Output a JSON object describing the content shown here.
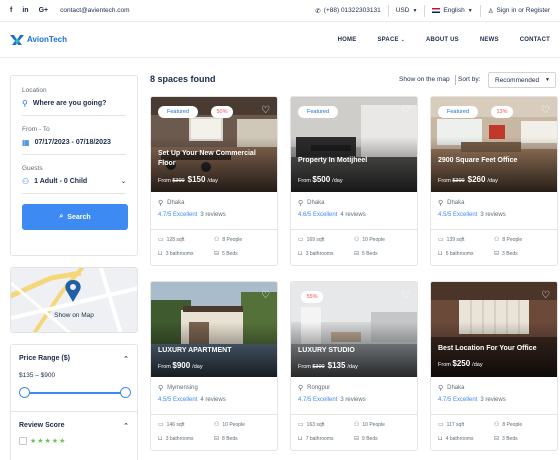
{
  "topbar": {
    "social": [
      "f",
      "in",
      "G+"
    ],
    "email": "contact@avientech.com",
    "phone": "(+88) 01322303131",
    "currency": "USD",
    "language": "English",
    "signin": "Sign in or Register"
  },
  "nav": {
    "logo": "AvionTech",
    "items": [
      "HOME",
      "SPACE",
      "ABOUT US",
      "NEWS",
      "CONTACT"
    ]
  },
  "search": {
    "location_label": "Location",
    "location_placeholder": "Where are you going?",
    "date_label": "From - To",
    "date_value": "07/17/2023 - 07/18/2023",
    "guests_label": "Guests",
    "guests_value": "1 Adult - 0 Child",
    "button": "Search"
  },
  "map": {
    "label": "Show on Map"
  },
  "filters": {
    "price_title": "Price Range ($)",
    "price_range": "$135 – $900",
    "price_min_fraction": 0.0,
    "price_max_fraction": 1.0,
    "review_title": "Review Score",
    "review_stars": 5
  },
  "results": {
    "count_label": "8 spaces found",
    "map_toggle": "Show on the map",
    "sort_label": "Sort by:",
    "sort_value": "Recommended"
  },
  "colors": {
    "accent": "#3d8bf2",
    "navy": "#1a2b48",
    "sale": "#f2514f",
    "green": "#6ac259"
  },
  "listings": [
    {
      "featured": "Featured",
      "discount": "50%",
      "title": "Set Up Your New Commercial Floor",
      "from": "From",
      "old_price": "$300",
      "price": "$150",
      "per": "/day",
      "location": "Dhaka",
      "rating": "4.7/5 Excellent",
      "reviews": "3 reviews",
      "area": "128 sqft",
      "people": "8 People",
      "baths": "3 bathrooms",
      "beds": "5 Beds"
    },
    {
      "featured": "Featured",
      "discount": "",
      "title": "Property In Motijheel",
      "from": "From",
      "old_price": "",
      "price": "$500",
      "per": "/day",
      "location": "Dhaka",
      "rating": "4.6/5 Excellent",
      "reviews": "4 reviews",
      "area": "169 sqft",
      "people": "10 People",
      "baths": "3 bathrooms",
      "beds": "5 Beds"
    },
    {
      "featured": "Featured",
      "discount": "13%",
      "title": "2900 Square Feet Office",
      "from": "From",
      "old_price": "$300",
      "price": "$260",
      "per": "/day",
      "location": "Dhaka",
      "rating": "4.5/5 Excellent",
      "reviews": "3 reviews",
      "area": "139 sqft",
      "people": "8 People",
      "baths": "5 bathrooms",
      "beds": "3 Beds"
    },
    {
      "featured": "",
      "discount": "",
      "title": "LUXURY APARTMENT",
      "from": "From",
      "old_price": "",
      "price": "$900",
      "per": "/day",
      "location": "Mymensing",
      "rating": "4.5/5 Excellent",
      "reviews": "4 reviews",
      "area": "146 sqft",
      "people": "10 People",
      "baths": "3 bathrooms",
      "beds": "8 Beds"
    },
    {
      "featured": "",
      "discount": "55%",
      "title": "LUXURY STUDIO",
      "from": "From",
      "old_price": "$300",
      "price": "$135",
      "per": "/day",
      "location": "Rongpur",
      "rating": "4.7/5 Excellent",
      "reviews": "3 reviews",
      "area": "163 sqft",
      "people": "10 People",
      "baths": "7 bathrooms",
      "beds": "9 Beds"
    },
    {
      "featured": "",
      "discount": "",
      "title": "Best Location For Your Office",
      "from": "From",
      "old_price": "",
      "price": "$250",
      "per": "/day",
      "location": "Dhaka",
      "rating": "4.7/5 Excellent",
      "reviews": "3 reviews",
      "area": "117 sqft",
      "people": "8 People",
      "baths": "4 bathrooms",
      "beds": "3 Beds"
    }
  ]
}
